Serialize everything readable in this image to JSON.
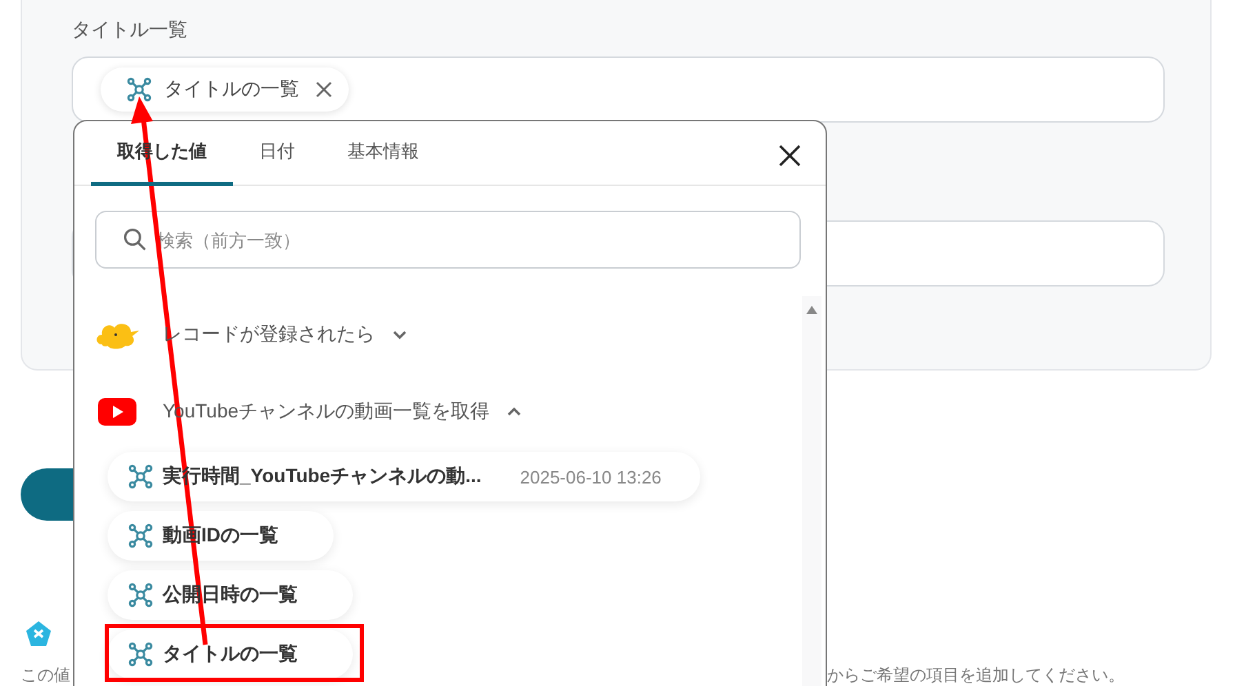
{
  "form": {
    "field_label": "タイトル一覧",
    "chips": [
      {
        "label": "タイトルの一覧"
      }
    ],
    "hint_start": "この値",
    "hint_end": "からご希望の項目を追加してください。"
  },
  "popup": {
    "tabs": [
      {
        "label": "取得した値",
        "selected": true
      },
      {
        "label": "日付",
        "selected": false
      },
      {
        "label": "基本情報",
        "selected": false
      }
    ],
    "search": {
      "placeholder": "検索（前方一致）"
    },
    "groups": [
      {
        "kind": "kintone",
        "title": "レコードが登録されたら",
        "expanded": false
      },
      {
        "kind": "youtube",
        "title": "YouTubeチャンネルの動画一覧を取得",
        "expanded": true,
        "items": [
          {
            "label": "実行時間_YouTubeチャンネルの動...",
            "value": "2025-06-10 13:26",
            "highlighted": false
          },
          {
            "label": "動画IDの一覧",
            "highlighted": false
          },
          {
            "label": "公開日時の一覧",
            "highlighted": false
          },
          {
            "label": "タイトルの一覧",
            "highlighted": true
          }
        ]
      }
    ]
  }
}
